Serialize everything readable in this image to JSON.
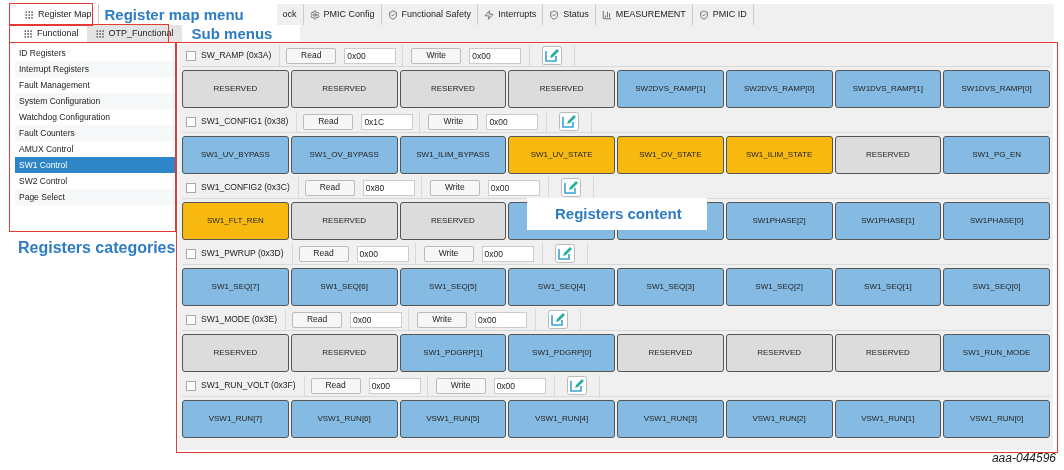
{
  "tabs": [
    {
      "label": "Register Map",
      "kind": "grid",
      "selected": true
    },
    {
      "label": "ock",
      "kind": "plain",
      "selected": false
    },
    {
      "label": "PMIC Config",
      "kind": "gear",
      "selected": false
    },
    {
      "label": "Functional Safety",
      "kind": "shield",
      "selected": false
    },
    {
      "label": "Interrupts",
      "kind": "bolt",
      "selected": false
    },
    {
      "label": "Status",
      "kind": "shield",
      "selected": false
    },
    {
      "label": "MEASUREMENT",
      "kind": "chart",
      "selected": false
    },
    {
      "label": "PMIC ID",
      "kind": "shield",
      "selected": false
    }
  ],
  "sub_tabs": [
    {
      "label": "Functional",
      "selected": true
    },
    {
      "label": "OTP_Functional",
      "selected": false
    }
  ],
  "callouts": {
    "register_map_menu": "Register map menu",
    "sub_menus": "Sub menus",
    "registers_categories": "Registers categories",
    "registers_content": "Registers content"
  },
  "categories": [
    {
      "label": "ID Registers",
      "selected": false
    },
    {
      "label": "Interrupt Registers",
      "selected": false
    },
    {
      "label": "Fault Management",
      "selected": false
    },
    {
      "label": "System Configuration",
      "selected": false
    },
    {
      "label": "Watchdog Configuration",
      "selected": false
    },
    {
      "label": "Fault Counters",
      "selected": false
    },
    {
      "label": "AMUX Control",
      "selected": false
    },
    {
      "label": "SW1 Control",
      "selected": true
    },
    {
      "label": "SW2 Control",
      "selected": false
    },
    {
      "label": "Page Select",
      "selected": false
    }
  ],
  "registers": [
    {
      "name": "SW_RAMP (0x3A)",
      "checked": false,
      "read_button": "Read",
      "read_value": "0x00",
      "write_button": "Write",
      "write_value": "0x00",
      "bits": [
        {
          "label": "RESERVED",
          "color": "#dcdcdc"
        },
        {
          "label": "RESERVED",
          "color": "#dcdcdc"
        },
        {
          "label": "RESERVED",
          "color": "#dcdcdc"
        },
        {
          "label": "RESERVED",
          "color": "#dcdcdc"
        },
        {
          "label": "SW2DVS_RAMP[1]",
          "color": "#85bbe3"
        },
        {
          "label": "SW2DVS_RAMP[0]",
          "color": "#85bbe3"
        },
        {
          "label": "SW1DVS_RAMP[1]",
          "color": "#85bbe3"
        },
        {
          "label": "SW1DVS_RAMP[0]",
          "color": "#85bbe3"
        }
      ]
    },
    {
      "name": "SW1_CONFIG1 (0x38)",
      "checked": false,
      "read_button": "Read",
      "read_value": "0x1C",
      "write_button": "Write",
      "write_value": "0x00",
      "bits": [
        {
          "label": "SW1_UV_BYPASS",
          "color": "#85bbe3"
        },
        {
          "label": "SW1_OV_BYPASS",
          "color": "#85bbe3"
        },
        {
          "label": "SW1_ILIM_BYPASS",
          "color": "#85bbe3"
        },
        {
          "label": "SW1_UV_STATE",
          "color": "#f7b90f"
        },
        {
          "label": "SW1_OV_STATE",
          "color": "#f7b90f"
        },
        {
          "label": "SW1_ILIM_STATE",
          "color": "#f7b90f"
        },
        {
          "label": "RESERVED",
          "color": "#dcdcdc"
        },
        {
          "label": "SW1_PG_EN",
          "color": "#85bbe3"
        }
      ]
    },
    {
      "name": "SW1_CONFIG2 (0x3C)",
      "checked": false,
      "read_button": "Read",
      "read_value": "0x80",
      "write_button": "Write",
      "write_value": "0x00",
      "bits": [
        {
          "label": "SW1_FLT_REN",
          "color": "#f7b90f"
        },
        {
          "label": "RESERVED",
          "color": "#dcdcdc"
        },
        {
          "label": "RESERVED",
          "color": "#dcdcdc"
        },
        {
          "color": "#85bbe3"
        },
        {
          "color": "#85bbe3"
        },
        {
          "label": "SW1PHASE[2]",
          "color": "#85bbe3"
        },
        {
          "label": "SW1PHASE[1]",
          "color": "#85bbe3"
        },
        {
          "label": "SW1PHASE[0]",
          "color": "#85bbe3"
        }
      ]
    },
    {
      "name": "SW1_PWRUP (0x3D)",
      "checked": false,
      "read_button": "Read",
      "read_value": "0x00",
      "write_button": "Write",
      "write_value": "0x00",
      "bits": [
        {
          "label": "SW1_SEQ[7]",
          "color": "#85bbe3"
        },
        {
          "label": "SW1_SEQ[6]",
          "color": "#85bbe3"
        },
        {
          "label": "SW1_SEQ[5]",
          "color": "#85bbe3"
        },
        {
          "label": "SW1_SEQ[4]",
          "color": "#85bbe3"
        },
        {
          "label": "SW1_SEQ[3]",
          "color": "#85bbe3"
        },
        {
          "label": "SW1_SEQ[2]",
          "color": "#85bbe3"
        },
        {
          "label": "SW1_SEQ[1]",
          "color": "#85bbe3"
        },
        {
          "label": "SW1_SEQ[0]",
          "color": "#85bbe3"
        }
      ]
    },
    {
      "name": "SW1_MODE (0x3E)",
      "checked": false,
      "read_button": "Read",
      "read_value": "0x00",
      "write_button": "Write",
      "write_value": "0x00",
      "bits": [
        {
          "label": "RESERVED",
          "color": "#dcdcdc"
        },
        {
          "label": "RESERVED",
          "color": "#dcdcdc"
        },
        {
          "label": "SW1_PDGRP[1]",
          "color": "#85bbe3"
        },
        {
          "label": "SW1_PDGRP[0]",
          "color": "#85bbe3"
        },
        {
          "label": "RESERVED",
          "color": "#dcdcdc"
        },
        {
          "label": "RESERVED",
          "color": "#dcdcdc"
        },
        {
          "label": "RESERVED",
          "color": "#dcdcdc"
        },
        {
          "label": "SW1_RUN_MODE",
          "color": "#85bbe3"
        }
      ]
    },
    {
      "name": "SW1_RUN_VOLT (0x3F)",
      "checked": false,
      "read_button": "Read",
      "read_value": "0x00",
      "write_button": "Write",
      "write_value": "0x00",
      "bits": [
        {
          "label": "VSW1_RUN[7]",
          "color": "#85bbe3"
        },
        {
          "label": "VSW1_RUN[6]",
          "color": "#85bbe3"
        },
        {
          "label": "VSW1_RUN[5]",
          "color": "#85bbe3"
        },
        {
          "label": "VSW1_RUN[4]",
          "color": "#85bbe3"
        },
        {
          "label": "VSW1_RUN[3]",
          "color": "#85bbe3"
        },
        {
          "label": "VSW1_RUN[2]",
          "color": "#85bbe3"
        },
        {
          "label": "VSW1_RUN[1]",
          "color": "#85bbe3"
        },
        {
          "label": "VSW1_RUN[0]",
          "color": "#85bbe3"
        }
      ]
    }
  ],
  "figure_id": "aaa-044596"
}
